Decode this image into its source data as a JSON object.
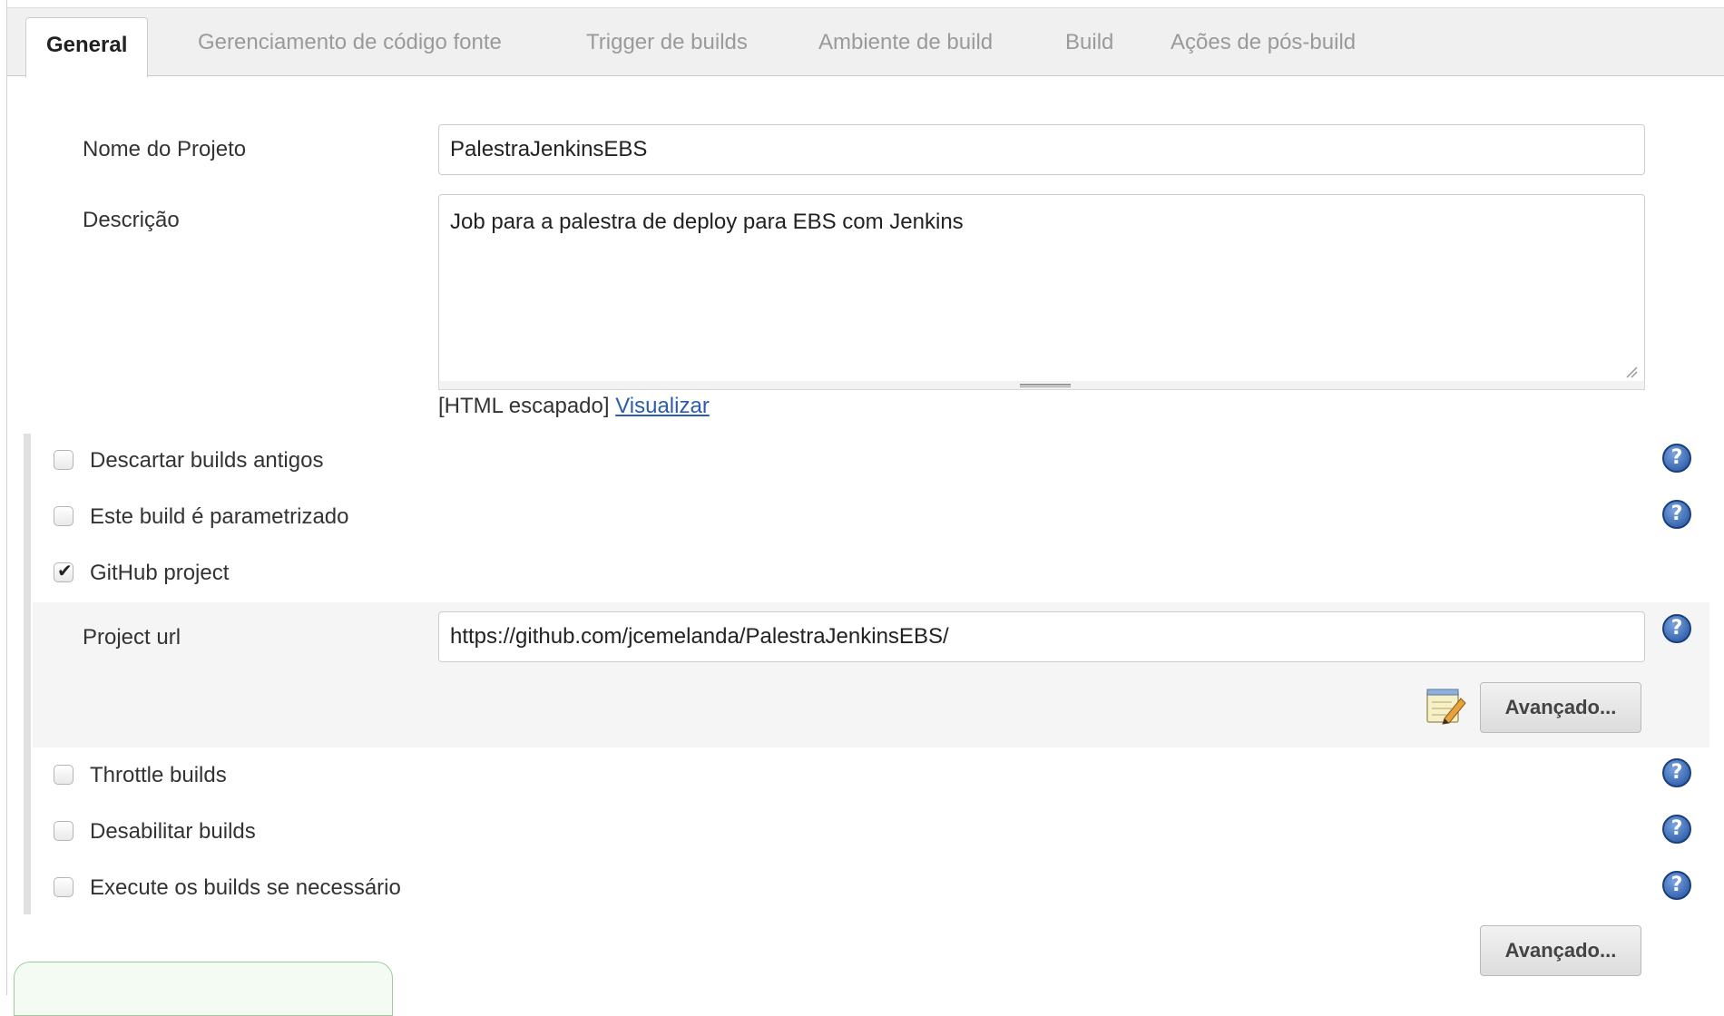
{
  "tabs": [
    {
      "label": "General"
    },
    {
      "label": "Gerenciamento de código fonte"
    },
    {
      "label": "Trigger de builds"
    },
    {
      "label": "Ambiente de build"
    },
    {
      "label": "Build"
    },
    {
      "label": "Ações de pós-build"
    }
  ],
  "form": {
    "project_name_label": "Nome do Projeto",
    "project_name_value": "PalestraJenkinsEBS",
    "description_label": "Descrição",
    "description_value": "Job para a palestra de deploy para EBS com Jenkins",
    "html_note": "[HTML escapado]",
    "preview_link": "Visualizar"
  },
  "options": [
    {
      "label": "Descartar builds antigos",
      "checked": false
    },
    {
      "label": "Este build é parametrizado",
      "checked": false
    },
    {
      "label": "GitHub project",
      "checked": true
    },
    {
      "label": "Throttle builds",
      "checked": false
    },
    {
      "label": "Desabilitar builds",
      "checked": false
    },
    {
      "label": "Execute os builds se necessário",
      "checked": false
    }
  ],
  "github": {
    "url_label": "Project url",
    "url_value": "https://github.com/jcemelanda/PalestraJenkinsEBS/"
  },
  "buttons": {
    "advanced_github": "Avançado...",
    "advanced_general": "Avançado..."
  },
  "icons": {
    "help": "help-icon",
    "checkmark": "✔",
    "help_glyph": "?"
  },
  "colors": {
    "link": "#2a5db0",
    "help_blue": "#1f4f9c",
    "tab_bg": "#f0f0f0"
  }
}
